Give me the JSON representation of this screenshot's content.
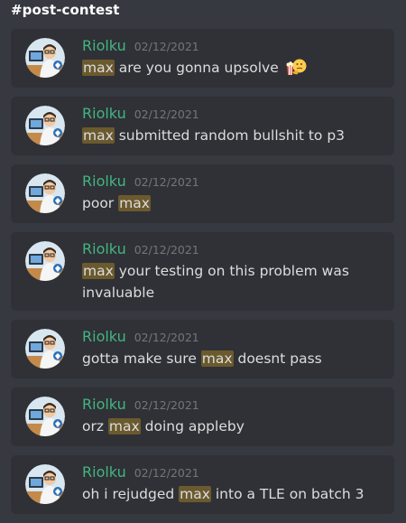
{
  "channel": {
    "name": "#post-contest"
  },
  "colors": {
    "background": "#36393f",
    "card": "#2f3136",
    "username": "#43b581",
    "timestamp": "#72767d",
    "text": "#dcddde",
    "mention_highlight": "#6b5a2e"
  },
  "messages": [
    {
      "author": "Riolku",
      "timestamp": "02/12/2021",
      "before": "",
      "mention": "max",
      "after": " are you gonna upsolve",
      "emoji": "popcorn-and-thinking-emoji"
    },
    {
      "author": "Riolku",
      "timestamp": "02/12/2021",
      "before": "",
      "mention": "max",
      "after": " submitted random bullshit to p3"
    },
    {
      "author": "Riolku",
      "timestamp": "02/12/2021",
      "before": "poor ",
      "mention": "max",
      "after": ""
    },
    {
      "author": "Riolku",
      "timestamp": "02/12/2021",
      "before": "",
      "mention": "max",
      "after": " your testing on this problem was invaluable"
    },
    {
      "author": "Riolku",
      "timestamp": "02/12/2021",
      "before": "gotta make sure ",
      "mention": "max",
      "after": " doesnt pass"
    },
    {
      "author": "Riolku",
      "timestamp": "02/12/2021",
      "before": "orz ",
      "mention": "max",
      "after": " doing appleby"
    },
    {
      "author": "Riolku",
      "timestamp": "02/12/2021",
      "before": "oh i rejudged ",
      "mention": "max",
      "after": " into a TLE on batch 3"
    }
  ]
}
